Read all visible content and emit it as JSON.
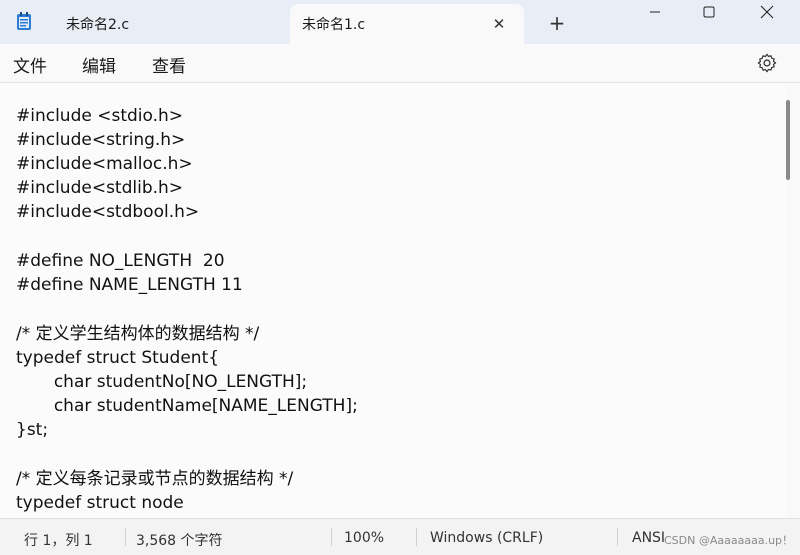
{
  "tabs": [
    {
      "label": "未命名2.c"
    },
    {
      "label": "未命名1.c"
    }
  ],
  "icons": {
    "app": "notepad-icon",
    "tab_close": "close-icon",
    "new_tab": "plus-icon",
    "minimize": "minimize-icon",
    "maximize": "maximize-icon",
    "close": "close-icon",
    "settings": "gear-icon"
  },
  "glyphs": {
    "tab_close": "✕",
    "new_tab": "+"
  },
  "menu": [
    "文件",
    "编辑",
    "查看"
  ],
  "code_lines": [
    "",
    "#include <stdio.h>",
    "#include<string.h>",
    "#include<malloc.h>",
    "#include<stdlib.h>",
    "#include<stdbool.h>",
    "",
    "#define NO_LENGTH  20",
    "#define NAME_LENGTH 11",
    "",
    "/* 定义学生结构体的数据结构 */",
    "typedef struct Student{",
    "       char studentNo[NO_LENGTH];",
    "       char studentName[NAME_LENGTH];",
    "}st;",
    "",
    "/* 定义每条记录或节点的数据结构 */",
    "typedef struct node"
  ],
  "status": {
    "position": "行 1，列 1",
    "chars": "3,568 个字符",
    "zoom": "100%",
    "line_ending": "Windows (CRLF)",
    "encoding": "ANSI"
  },
  "watermark": "CSDN @Aaaaaaaa.up！",
  "colors": {
    "titlebar": "#e9eef6",
    "background": "#f9f9f9"
  }
}
